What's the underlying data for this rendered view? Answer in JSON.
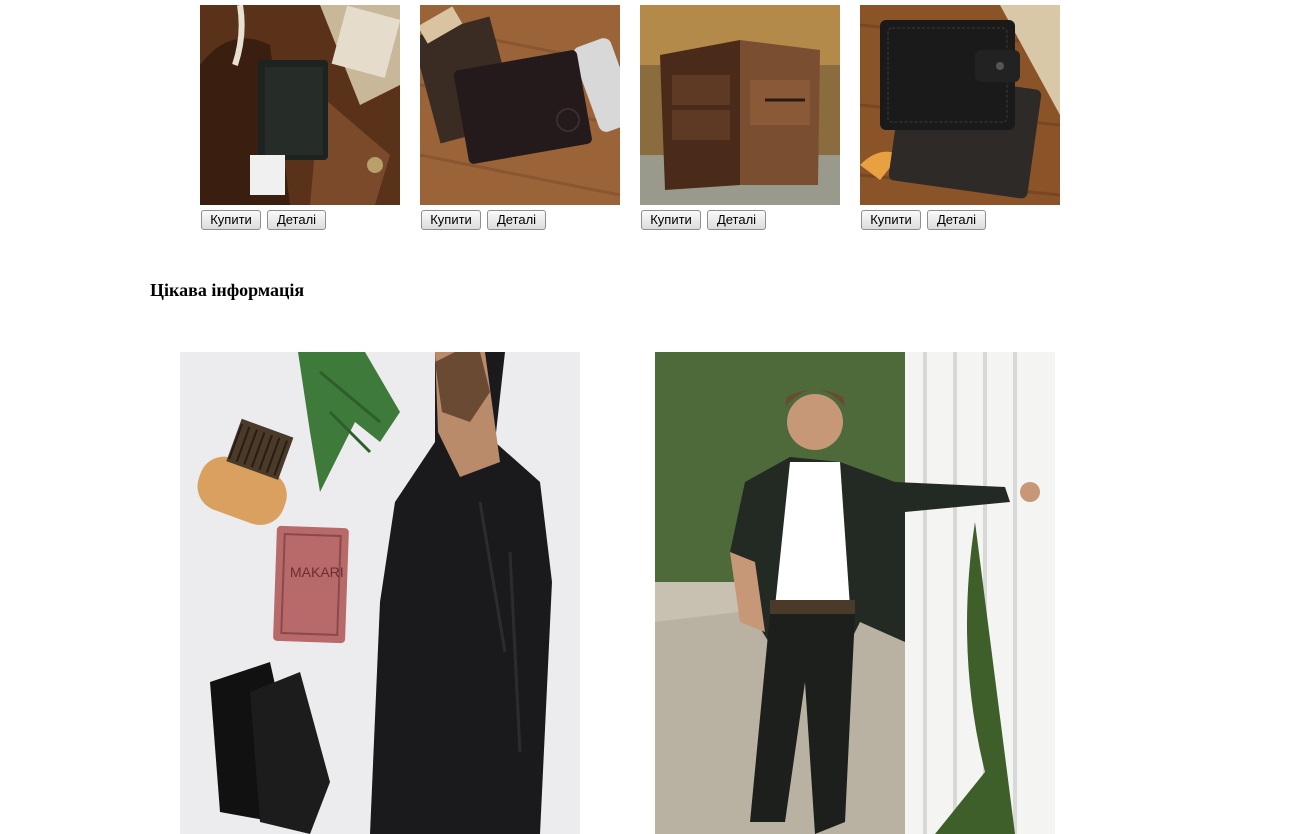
{
  "products": [
    {
      "image_icon": "wallet-photo-1",
      "buy_label": "Купити",
      "details_label": "Деталі"
    },
    {
      "image_icon": "wallet-photo-2",
      "buy_label": "Купити",
      "details_label": "Деталі"
    },
    {
      "image_icon": "wallet-photo-3",
      "buy_label": "Купити",
      "details_label": "Деталі"
    },
    {
      "image_icon": "wallet-photo-4",
      "buy_label": "Купити",
      "details_label": "Деталі"
    }
  ],
  "info": {
    "title": "Цікава інформація",
    "photos": [
      "grooming-flatlay-photo",
      "man-in-suit-photo"
    ],
    "soap_logo": "MAKARI"
  }
}
